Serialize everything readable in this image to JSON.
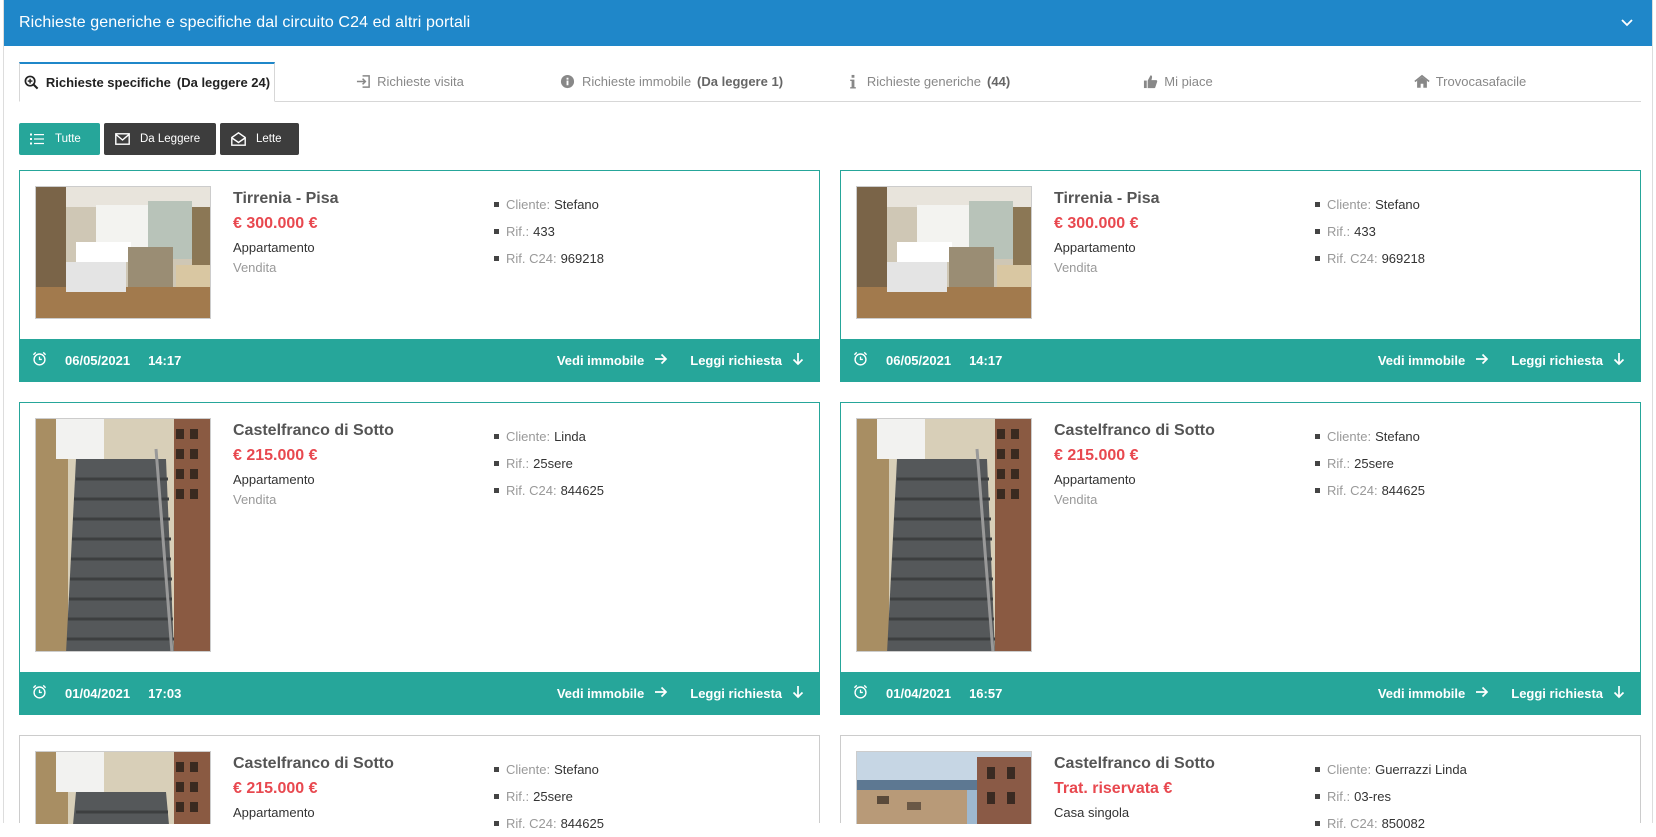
{
  "header": {
    "title": "Richieste generiche e specifiche dal circuito C24 ed altri portali"
  },
  "tabs": [
    {
      "label": "Richieste specifiche",
      "badge": "(Da leggere 24)",
      "icon": "search-plus-icon",
      "active": true
    },
    {
      "label": "Richieste visita",
      "badge": "",
      "icon": "sign-in-icon",
      "active": false
    },
    {
      "label": "Richieste immobile",
      "badge": "(Da leggere 1)",
      "icon": "info-circle-icon",
      "active": false
    },
    {
      "label": "Richieste generiche",
      "badge": "(44)",
      "icon": "info-icon",
      "active": false
    },
    {
      "label": "Mi piace",
      "badge": "",
      "icon": "thumbs-up-icon",
      "active": false
    },
    {
      "label": "Trovocasafacile",
      "badge": "",
      "icon": "home-icon",
      "active": false
    }
  ],
  "filters": [
    {
      "label": "Tutte",
      "icon": "list-icon"
    },
    {
      "label": "Da Leggere",
      "icon": "envelope-icon"
    },
    {
      "label": "Lette",
      "icon": "envelope-open-icon"
    }
  ],
  "labels": {
    "cliente": "Cliente:",
    "rif": "Rif.:",
    "rif_c24": "Rif. C24:",
    "vedi": "Vedi immobile",
    "leggi": "Leggi richiesta"
  },
  "colors": {
    "header": "#1f87c9",
    "accent": "#26a69a",
    "price": "#e8484f"
  },
  "cards": [
    {
      "city": "Tirrenia - Pisa",
      "price": "€ 300.000 €",
      "type": "Appartamento",
      "contract": "Vendita",
      "cliente": "Stefano",
      "rif": "433",
      "rif_c24": "969218",
      "date": "06/05/2021",
      "time": "14:17",
      "photo": "kitchen"
    },
    {
      "city": "Tirrenia - Pisa",
      "price": "€ 300.000 €",
      "type": "Appartamento",
      "contract": "Vendita",
      "cliente": "Stefano",
      "rif": "433",
      "rif_c24": "969218",
      "date": "06/05/2021",
      "time": "14:17",
      "photo": "kitchen"
    },
    {
      "city": "Castelfranco di Sotto",
      "price": "€ 215.000 €",
      "type": "Appartamento",
      "contract": "Vendita",
      "cliente": "Linda",
      "rif": "25sere",
      "rif_c24": "844625",
      "date": "01/04/2021",
      "time": "17:03",
      "photo": "stairs"
    },
    {
      "city": "Castelfranco di Sotto",
      "price": "€ 215.000 €",
      "type": "Appartamento",
      "contract": "Vendita",
      "cliente": "Stefano",
      "rif": "25sere",
      "rif_c24": "844625",
      "date": "01/04/2021",
      "time": "16:57",
      "photo": "stairs"
    },
    {
      "city": "Castelfranco di Sotto",
      "price": "€ 215.000 €",
      "type": "Appartamento",
      "contract": "",
      "cliente": "Stefano",
      "rif": "25sere",
      "rif_c24": "844625",
      "date": "",
      "time": "",
      "photo": "stairs"
    },
    {
      "city": "Castelfranco di Sotto",
      "price": "Trat. riservata €",
      "type": "Casa singola",
      "contract": "",
      "cliente": "Guerrazzi Linda",
      "rif": "03-res",
      "rif_c24": "850082",
      "date": "",
      "time": "",
      "photo": "harbour"
    }
  ]
}
